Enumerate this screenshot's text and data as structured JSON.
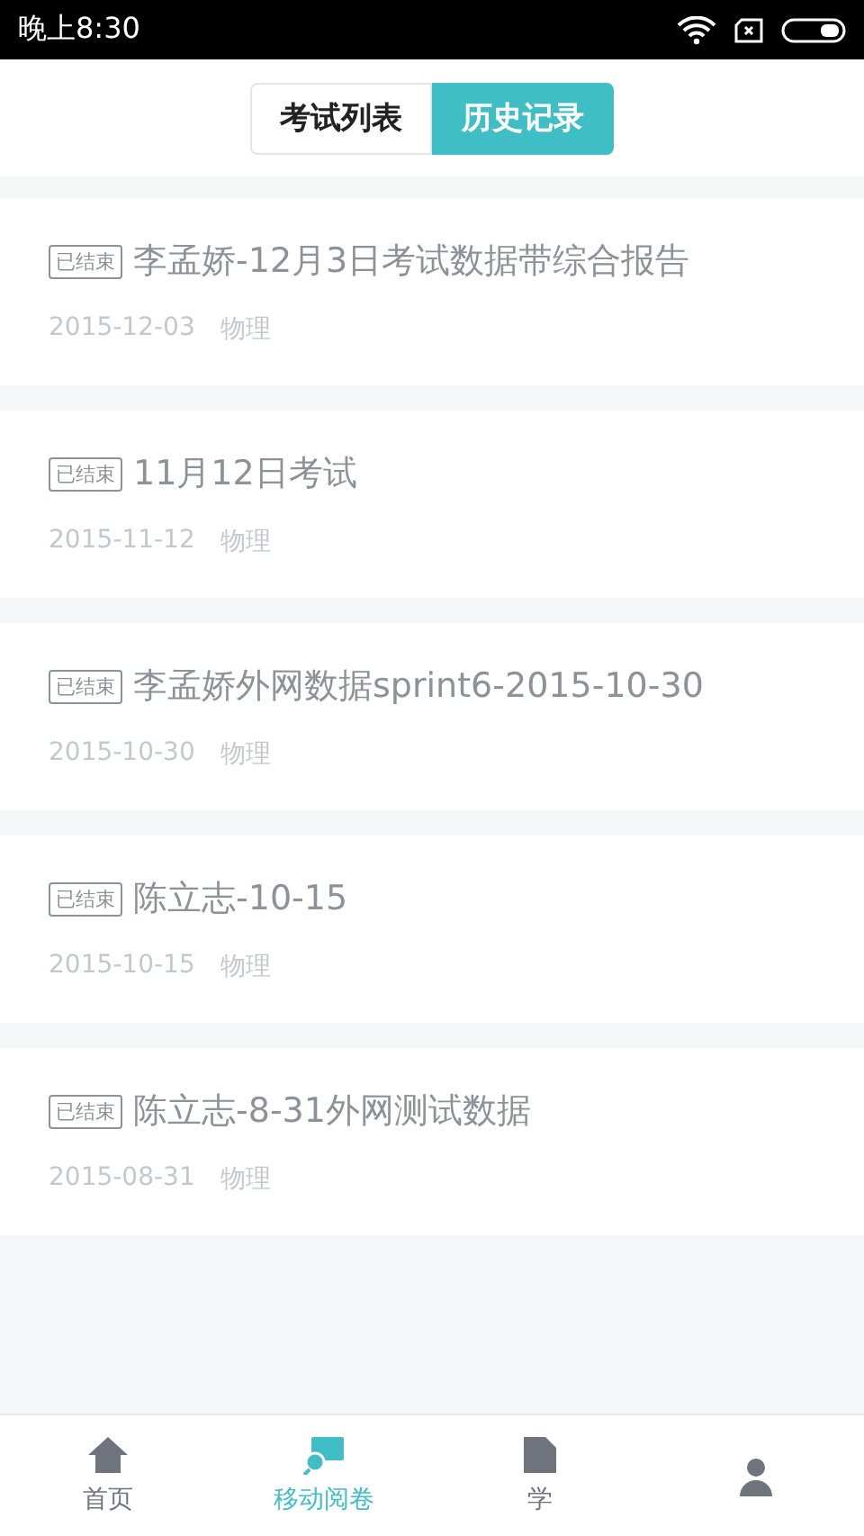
{
  "status_bar": {
    "time": "晚上8:30"
  },
  "tabs": [
    {
      "label": "考试列表",
      "selected": false
    },
    {
      "label": "历史记录",
      "selected": true
    }
  ],
  "exams": [
    {
      "badge": "已结束",
      "title": "李孟娇-12月3日考试数据带综合报告",
      "date": "2015-12-03",
      "subject": "物理"
    },
    {
      "badge": "已结束",
      "title": "11月12日考试",
      "date": "2015-11-12",
      "subject": "物理"
    },
    {
      "badge": "已结束",
      "title": "李孟娇外网数据sprint6-2015-10-30",
      "date": "2015-10-30",
      "subject": "物理"
    },
    {
      "badge": "已结束",
      "title": "陈立志-10-15",
      "date": "2015-10-15",
      "subject": "物理"
    },
    {
      "badge": "已结束",
      "title": "陈立志-8-31外网测试数据",
      "date": "2015-08-31",
      "subject": "物理"
    }
  ],
  "bottom_nav": [
    {
      "kind": "home",
      "label": "首页",
      "selected": false
    },
    {
      "kind": "review",
      "label": "移动阅卷",
      "selected": true
    },
    {
      "kind": "report",
      "label": "学",
      "selected": false
    },
    {
      "kind": "profile",
      "selected": false
    }
  ]
}
